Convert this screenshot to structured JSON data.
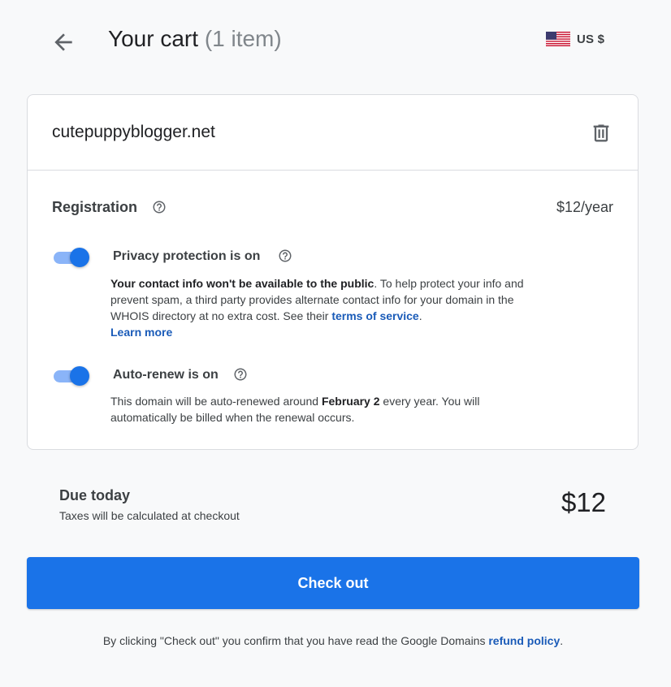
{
  "header": {
    "title": "Your cart",
    "item_count": "(1 item)",
    "currency": "US $",
    "flag_icon": "us-flag-icon",
    "back_icon": "arrow-left-icon"
  },
  "cart_item": {
    "domain": "cutepuppyblogger.net",
    "delete_icon": "trash-icon",
    "registration_label": "Registration",
    "registration_price": "$12/year",
    "privacy": {
      "title": "Privacy protection is on",
      "enabled": true,
      "desc_bold": "Your contact info won't be available to the public",
      "desc_text": ". To help protect your info and prevent spam, a third party provides alternate contact info for your domain in the WHOIS directory at no extra cost. See their ",
      "terms_link": "terms of service",
      "desc_end": ".",
      "learn_more": "Learn more"
    },
    "auto_renew": {
      "title": "Auto-renew is on",
      "enabled": true,
      "desc_start": "This domain will be auto-renewed around ",
      "date": "February 2",
      "desc_end": " every year. You will automatically be billed when the renewal occurs."
    }
  },
  "summary": {
    "due_label": "Due today",
    "taxes_note": "Taxes will be calculated at checkout",
    "amount": "$12"
  },
  "checkout_button": "Check out",
  "footer": {
    "text": "By clicking \"Check out\" you confirm that you have read the Google Domains ",
    "link": "refund policy",
    "end": "."
  },
  "colors": {
    "accent": "#1a73e8",
    "toggle_track": "#8ab4f8",
    "link": "#1a5bb8",
    "background": "#f8f9fa"
  }
}
